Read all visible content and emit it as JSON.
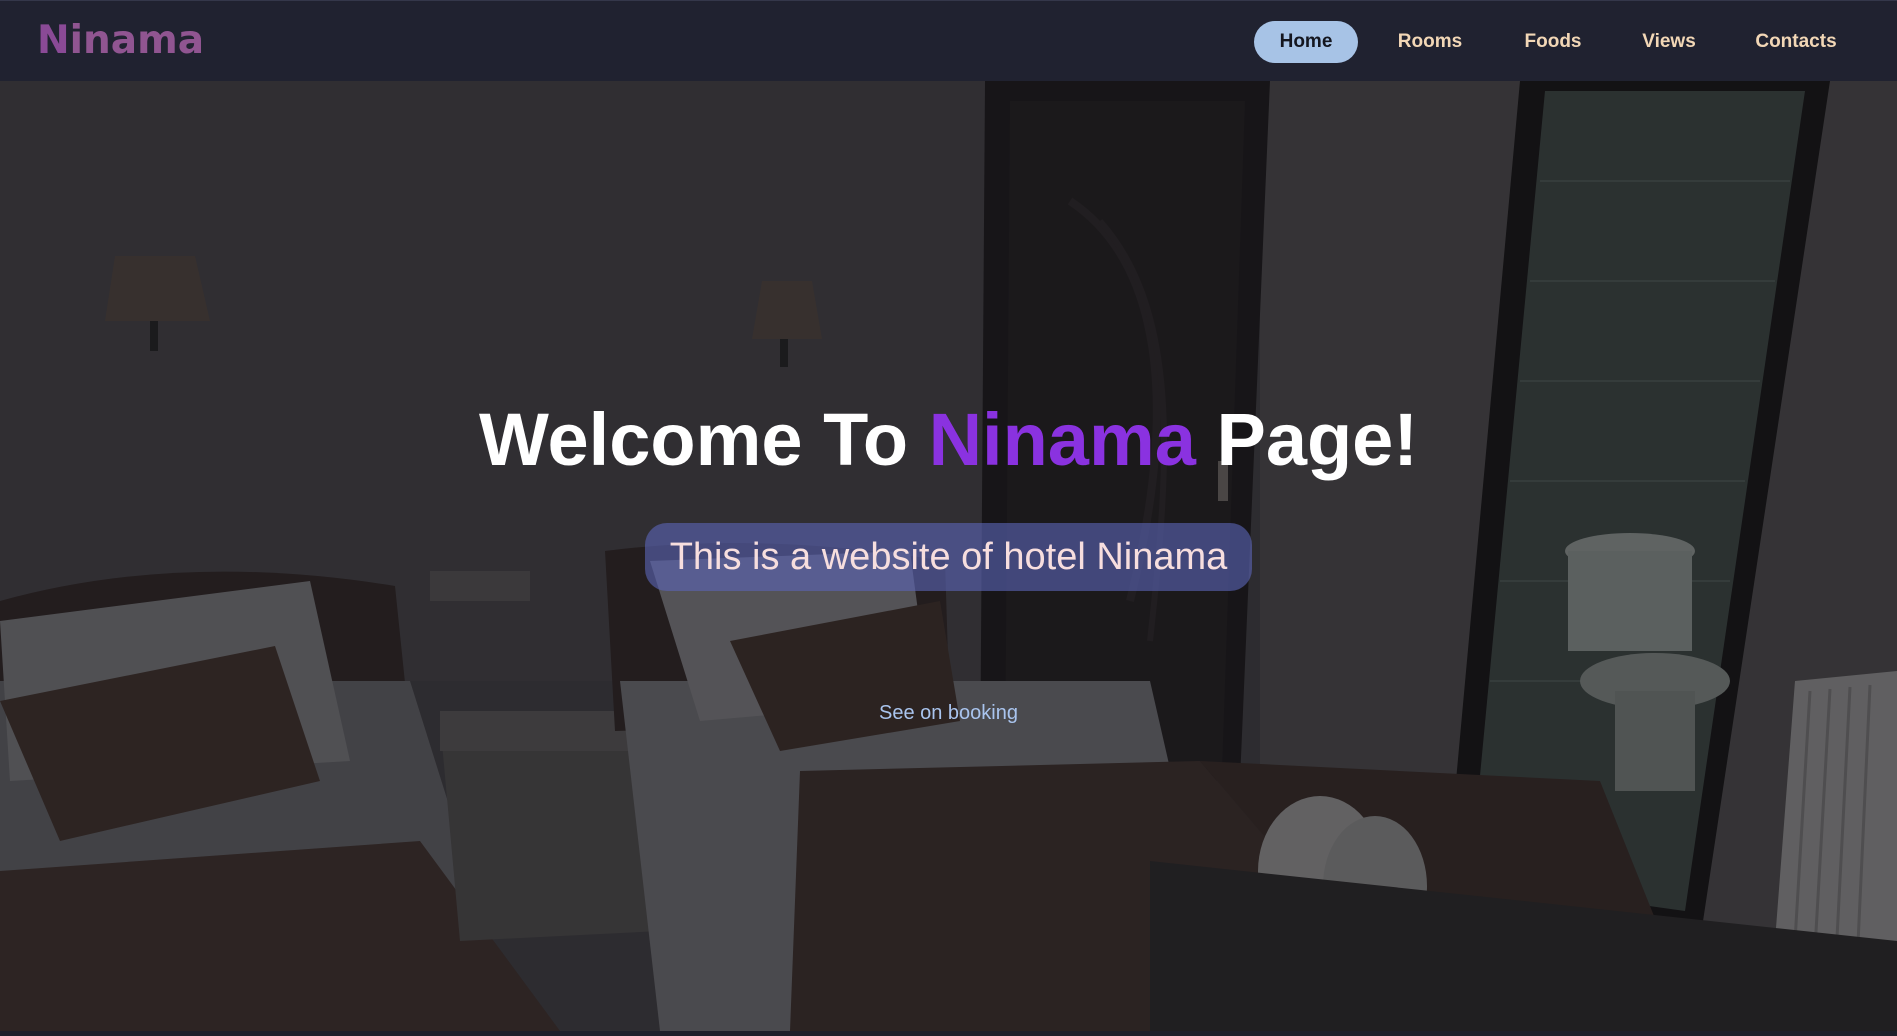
{
  "logo": {
    "first_letter": "N",
    "rest": "inama"
  },
  "nav": {
    "items": [
      {
        "label": "Home",
        "active": true
      },
      {
        "label": "Rooms",
        "active": false
      },
      {
        "label": "Foods",
        "active": false
      },
      {
        "label": "Views",
        "active": false
      },
      {
        "label": "Contacts",
        "active": false
      }
    ]
  },
  "hero": {
    "title_before": "Welcome To ",
    "title_brand": "Ninama",
    "title_after": " Page!",
    "subtitle": "This is a website of hotel Ninama",
    "link": "See on booking"
  },
  "colors": {
    "navbar_bg": "#202230",
    "nav_text": "#f2d7b6",
    "nav_active_bg": "#a7c3e6",
    "brand_purple": "#8a32e0",
    "subtitle_bg": "#5a64b4",
    "link_color": "#a9c4ee"
  }
}
